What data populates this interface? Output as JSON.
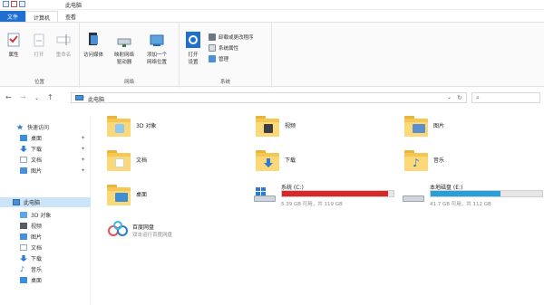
{
  "window": {
    "title": "此电脑"
  },
  "tabs": [
    "文件",
    "计算机",
    "查看"
  ],
  "ribbon": {
    "location": {
      "label": "位置",
      "buttons": [
        {
          "label": "属性",
          "icon": "properties-icon"
        },
        {
          "label": "打开",
          "icon": "open-icon"
        },
        {
          "label": "重命名",
          "icon": "rename-icon"
        }
      ]
    },
    "network": {
      "label": "网络",
      "buttons": [
        {
          "label": "访问媒体",
          "icon": "media-icon"
        },
        {
          "label": "映射网络\n驱动器",
          "icon": "map-drive-icon"
        },
        {
          "label": "添加一个\n网络位置",
          "icon": "network-location-icon"
        }
      ]
    },
    "system": {
      "label": "系统",
      "open_settings": "打开\n设置",
      "links": [
        "卸载或更改程序",
        "系统属性",
        "管理"
      ]
    }
  },
  "address": {
    "path": "此电脑"
  },
  "nav": {
    "items": [
      {
        "label": "快速访问",
        "icon": "star-icon",
        "color": "#2a7ad6",
        "pinned": false
      },
      {
        "label": "桌面",
        "icon": "desktop-icon",
        "color": "#3b8fd9",
        "pinned": true
      },
      {
        "label": "下载",
        "icon": "download-icon",
        "color": "#2a7ad6",
        "pinned": true
      },
      {
        "label": "文档",
        "icon": "document-icon",
        "color": "#9aa8b6",
        "pinned": true
      },
      {
        "label": "图片",
        "icon": "pictures-icon",
        "color": "#4a90d9",
        "pinned": true
      },
      {
        "label": "此电脑",
        "icon": "computer-icon",
        "color": "#4a90d9",
        "pinned": false,
        "selected": true
      },
      {
        "label": "3D 对象",
        "icon": "3d-icon",
        "color": "#5aa7e6",
        "pinned": false
      },
      {
        "label": "视频",
        "icon": "video-icon",
        "color": "#555c66",
        "pinned": false
      },
      {
        "label": "图片",
        "icon": "pictures-icon",
        "color": "#4a90d9",
        "pinned": false
      },
      {
        "label": "文档",
        "icon": "document-icon",
        "color": "#9aa8b6",
        "pinned": false
      },
      {
        "label": "下载",
        "icon": "download-icon",
        "color": "#2a7ad6",
        "pinned": false
      },
      {
        "label": "音乐",
        "icon": "music-icon",
        "color": "#2a7ad6",
        "pinned": false
      },
      {
        "label": "桌面",
        "icon": "desktop-icon",
        "color": "#3b8fd9",
        "pinned": false
      }
    ]
  },
  "folders": [
    {
      "label": "3D 对象",
      "icon": "3d-objects-icon",
      "overlay": "#8ec9f0"
    },
    {
      "label": "视频",
      "icon": "video-folder-icon",
      "overlay": "#3a3f47"
    },
    {
      "label": "图片",
      "icon": "pictures-folder-icon",
      "overlay": "#5b8fd0"
    },
    {
      "label": "文档",
      "icon": "documents-folder-icon",
      "overlay": "#ffffff"
    },
    {
      "label": "下载",
      "icon": "downloads-folder-icon",
      "overlay": "#2a7ad6"
    },
    {
      "label": "音乐",
      "icon": "music-folder-icon",
      "overlay": "#2a7ad6"
    },
    {
      "label": "桌面",
      "icon": "desktop-folder-icon",
      "overlay": "#3b8fd9"
    }
  ],
  "drives": [
    {
      "label": "系统 (C:)",
      "free_text": "5.39 GB 可用，共 119 GB",
      "used_fraction": 0.955,
      "bar_color": "#da2626",
      "icon": "windows-drive-icon"
    },
    {
      "label": "本地磁盘 (E:)",
      "free_text": "41.7 GB 可用，共 112 GB",
      "used_fraction": 0.63,
      "bar_color": "#26a0da",
      "icon": "local-drive-icon"
    }
  ],
  "baidu": {
    "label": "百度网盘",
    "sub": "双击运行百度网盘",
    "icon": "baidu-netdisk-icon"
  }
}
